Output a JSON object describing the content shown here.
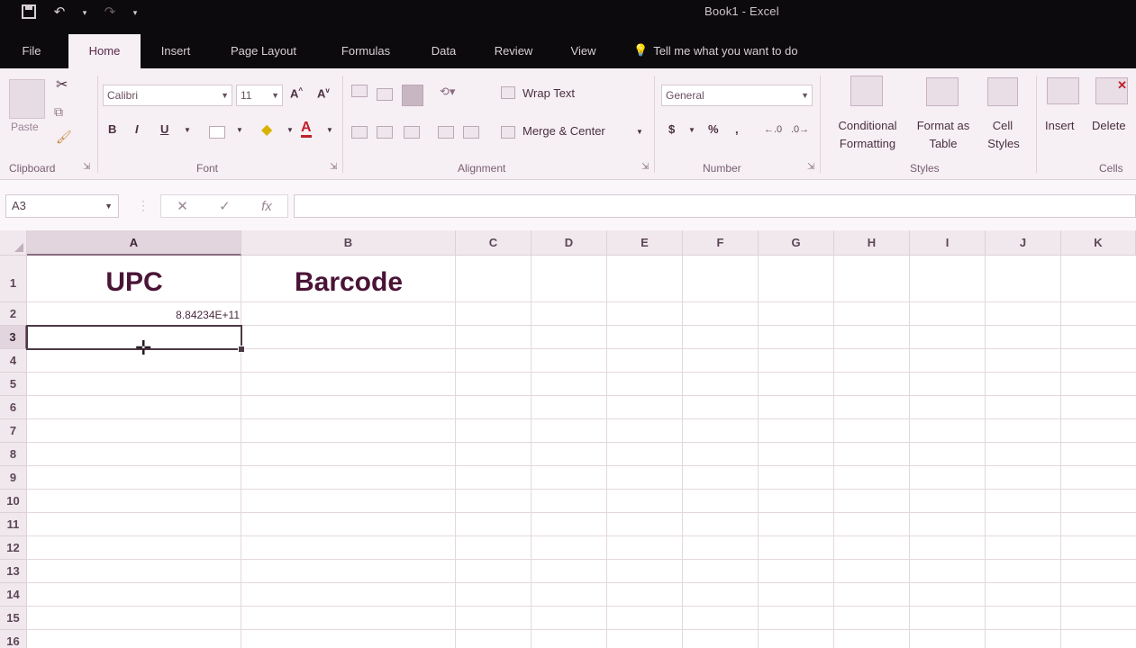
{
  "window": {
    "title": "Book1 - Excel"
  },
  "quick_access": {
    "save_icon": "save-icon",
    "undo_icon": "undo-icon",
    "redo_icon": "redo-icon"
  },
  "tabs": [
    {
      "label": "File"
    },
    {
      "label": "Home",
      "active": true
    },
    {
      "label": "Insert"
    },
    {
      "label": "Page Layout"
    },
    {
      "label": "Formulas"
    },
    {
      "label": "Data"
    },
    {
      "label": "Review"
    },
    {
      "label": "View"
    }
  ],
  "tell_me": {
    "label": "Tell me what you want to do"
  },
  "ribbon": {
    "clipboard": {
      "paste": "Paste",
      "group": "Clipboard"
    },
    "font": {
      "name": "Calibri",
      "size": "11",
      "bold": "B",
      "italic": "I",
      "underline": "U",
      "group": "Font"
    },
    "alignment": {
      "wrap_text": "Wrap Text",
      "merge_center": "Merge & Center",
      "group": "Alignment"
    },
    "number": {
      "format": "General",
      "currency": "$",
      "percent": "%",
      "comma": ",",
      "group": "Number"
    },
    "styles": {
      "conditional": "Conditional",
      "conditional2": "Formatting",
      "format_as": "Format as",
      "format_as2": "Table",
      "cell": "Cell",
      "cell2": "Styles",
      "group": "Styles"
    },
    "cells": {
      "insert": "Insert",
      "delete": "Delete",
      "group": "Cells"
    }
  },
  "formula_bar": {
    "name_box": "A3",
    "value": "",
    "fx": "fx"
  },
  "sheet": {
    "columns": [
      "A",
      "B",
      "C",
      "D",
      "E",
      "F",
      "G",
      "H",
      "I",
      "J",
      "K"
    ],
    "rows": [
      "1",
      "2",
      "3",
      "4",
      "5",
      "6",
      "7",
      "8",
      "9",
      "10",
      "11",
      "12",
      "13",
      "14",
      "15",
      "16"
    ],
    "cells": {
      "A1": "UPC",
      "B1": "Barcode",
      "A2": "8.84234E+11"
    },
    "selected_cell": "A3"
  },
  "colors": {
    "accent": "#4a1436",
    "titlebar": "#0c0a0c",
    "ribbon": "#f6eff4"
  }
}
